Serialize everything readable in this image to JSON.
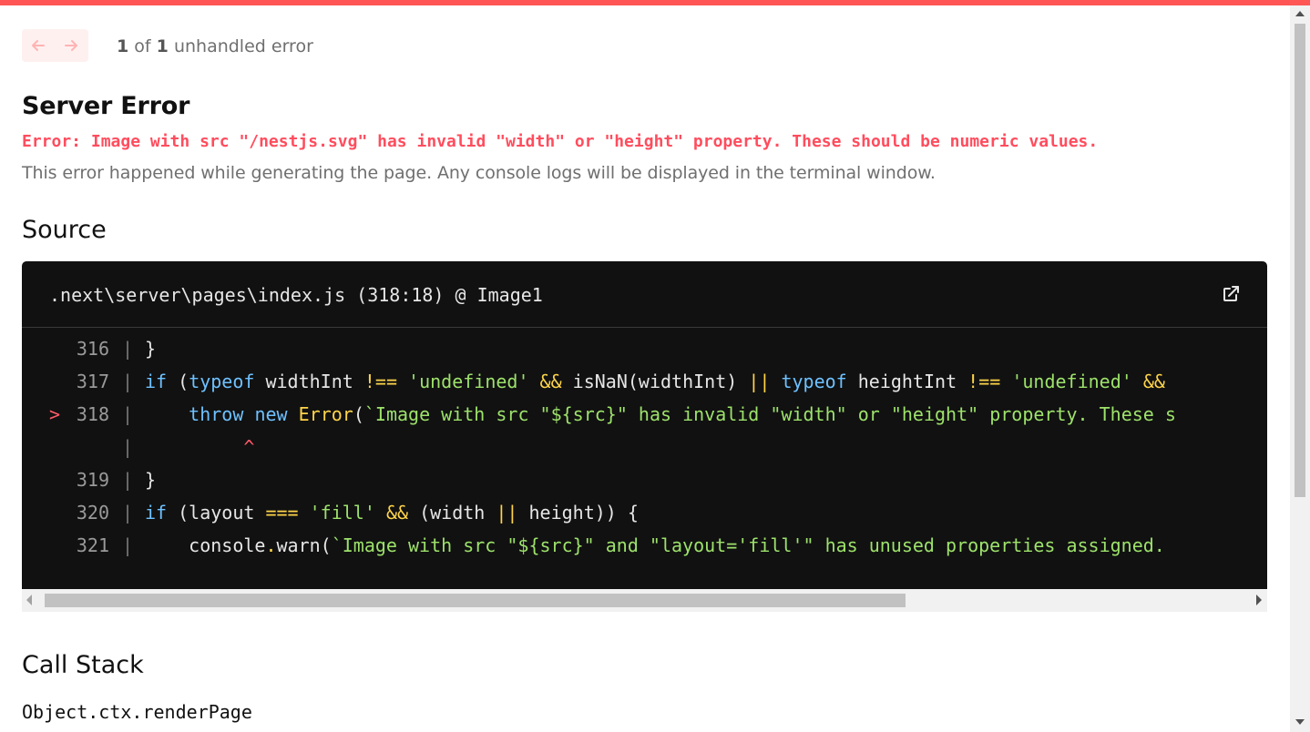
{
  "pagination": {
    "current": "1",
    "of": "of",
    "total": "1",
    "suffix": "unhandled error"
  },
  "error": {
    "title": "Server Error",
    "message": "Error: Image with src \"/nestjs.svg\" has invalid \"width\" or \"height\" property. These should be numeric values.",
    "description": "This error happened while generating the page. Any console logs will be displayed in the terminal window."
  },
  "source": {
    "heading": "Source",
    "file": ".next\\server\\pages\\index.js (318:18) @ Image1",
    "lines": [
      {
        "num": "316",
        "marker": "",
        "tokens": [
          [
            "p",
            "}"
          ]
        ]
      },
      {
        "num": "317",
        "marker": "",
        "tokens": [
          [
            "kw",
            "if"
          ],
          [
            "p",
            " ("
          ],
          [
            "kw",
            "typeof"
          ],
          [
            "p",
            " widthInt "
          ],
          [
            "op",
            "!=="
          ],
          [
            "p",
            " "
          ],
          [
            "str",
            "'undefined'"
          ],
          [
            "p",
            " "
          ],
          [
            "op",
            "&&"
          ],
          [
            "p",
            " isNaN(widthInt) "
          ],
          [
            "op",
            "||"
          ],
          [
            "p",
            " "
          ],
          [
            "kw",
            "typeof"
          ],
          [
            "p",
            " heightInt "
          ],
          [
            "op",
            "!=="
          ],
          [
            "p",
            " "
          ],
          [
            "str",
            "'undefined'"
          ],
          [
            "p",
            " "
          ],
          [
            "op",
            "&&"
          ]
        ]
      },
      {
        "num": "318",
        "marker": ">",
        "tokens": [
          [
            "p",
            "    "
          ],
          [
            "kw",
            "throw"
          ],
          [
            "p",
            " "
          ],
          [
            "kw",
            "new"
          ],
          [
            "p",
            " "
          ],
          [
            "fn",
            "Error"
          ],
          [
            "p",
            "("
          ],
          [
            "str",
            "`Image with src \"${src}\" has invalid \"width\" or \"height\" property. These s"
          ]
        ]
      },
      {
        "num": "",
        "marker": "",
        "tokens": [
          [
            "p",
            "         "
          ],
          [
            "caret",
            "^"
          ]
        ]
      },
      {
        "num": "319",
        "marker": "",
        "tokens": [
          [
            "p",
            "}"
          ]
        ]
      },
      {
        "num": "320",
        "marker": "",
        "tokens": [
          [
            "kw",
            "if"
          ],
          [
            "p",
            " (layout "
          ],
          [
            "op",
            "==="
          ],
          [
            "p",
            " "
          ],
          [
            "str",
            "'fill'"
          ],
          [
            "p",
            " "
          ],
          [
            "op",
            "&&"
          ],
          [
            "p",
            " (width "
          ],
          [
            "op",
            "||"
          ],
          [
            "p",
            " height)) {"
          ]
        ]
      },
      {
        "num": "321",
        "marker": "",
        "tokens": [
          [
            "p",
            "    console"
          ],
          [
            "op",
            "."
          ],
          [
            "p",
            "warn("
          ],
          [
            "str",
            "`Image with src \"${src}\" and \"layout='fill'\" has unused properties assigned."
          ]
        ]
      }
    ]
  },
  "callstack": {
    "heading": "Call Stack",
    "frames": [
      {
        "fn": "Object.ctx.renderPage"
      }
    ]
  },
  "icons": {
    "prev": "arrow-left-icon",
    "next": "arrow-right-icon",
    "external": "external-link-icon"
  },
  "colors": {
    "accent": "#ff5555",
    "error_text": "#ff4d5e",
    "code_bg": "#111111",
    "keyword": "#6ec1ff",
    "string": "#9de26b",
    "operator": "#ffd54a"
  }
}
